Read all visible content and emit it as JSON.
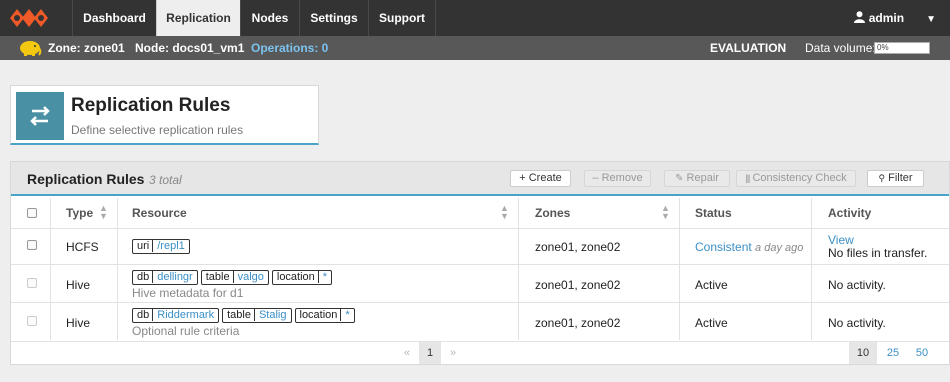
{
  "nav": {
    "tabs": [
      {
        "label": "Dashboard"
      },
      {
        "label": "Replication"
      },
      {
        "label": "Nodes"
      },
      {
        "label": "Settings"
      },
      {
        "label": "Support"
      }
    ],
    "user": "admin",
    "active_tab": "Replication"
  },
  "status": {
    "zone": "Zone: zone01",
    "node": "Node: docs01_vm1",
    "operations": "Operations: 0",
    "license": "EVALUATION",
    "data_volume_label": "Data volume:",
    "data_volume_value": "0%"
  },
  "header": {
    "title": "Replication Rules",
    "subtitle": "Define selective replication rules"
  },
  "panel": {
    "title": "Replication Rules",
    "count": "3 total",
    "buttons": {
      "create": "+ Create",
      "remove": "– Remove",
      "repair": "Repair",
      "consistency": "Consistency Check",
      "filter": "Filter"
    }
  },
  "table": {
    "columns": [
      "Type",
      "Resource",
      "Zones",
      "Status",
      "Activity"
    ],
    "rows": [
      {
        "type": "HCFS",
        "tags": [
          {
            "k": "uri",
            "v": "/repl1"
          }
        ],
        "note": "",
        "zones": "zone01, zone02",
        "status": "Consistent",
        "status_time": "a day ago",
        "activity_link": "View",
        "activity": "No files in transfer."
      },
      {
        "type": "Hive",
        "tags": [
          {
            "k": "db",
            "v": "dellingr"
          },
          {
            "k": "table",
            "v": "valgo"
          },
          {
            "k": "location",
            "v": "*"
          }
        ],
        "note": "Hive metadata for d1",
        "zones": "zone01, zone02",
        "status": "Active",
        "activity": "No activity."
      },
      {
        "type": "Hive",
        "tags": [
          {
            "k": "db",
            "v": "Riddermark"
          },
          {
            "k": "table",
            "v": "Stalig"
          },
          {
            "k": "location",
            "v": "*"
          }
        ],
        "note": "Optional rule criteria",
        "zones": "zone01, zone02",
        "status": "Active",
        "activity": "No activity."
      }
    ]
  },
  "pager": {
    "prev": "«",
    "current": "1",
    "next": "»",
    "sizes": [
      "10",
      "25",
      "50"
    ]
  }
}
